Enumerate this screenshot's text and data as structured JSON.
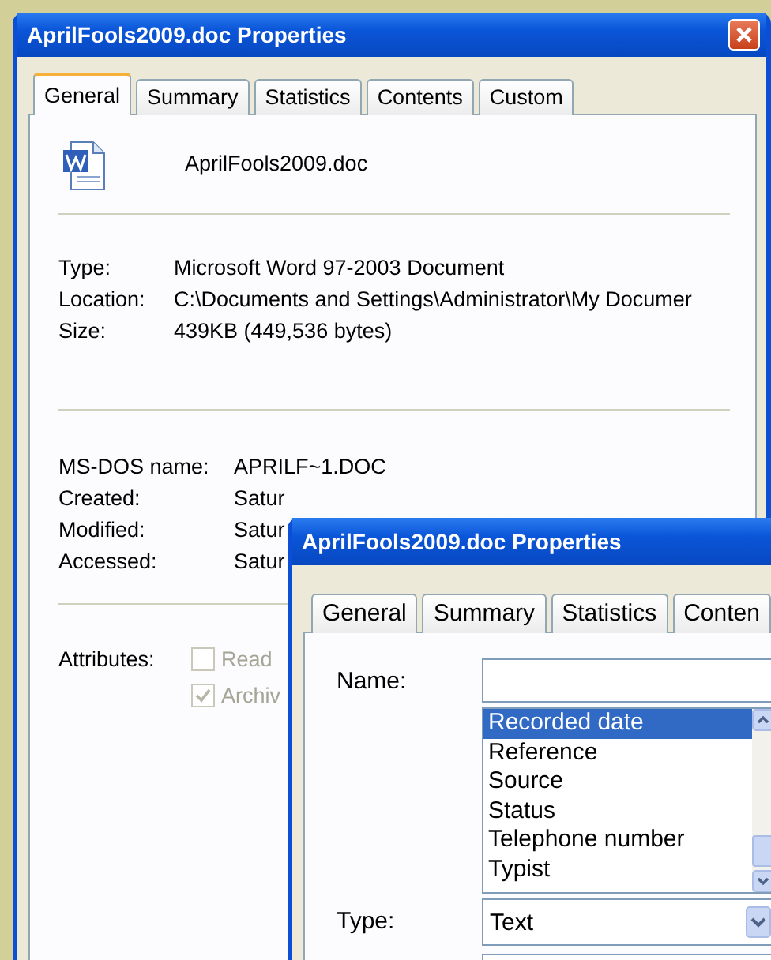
{
  "main_window": {
    "title": "AprilFools2009.doc Properties",
    "tabs": [
      {
        "label": "General",
        "selected": true
      },
      {
        "label": "Summary",
        "selected": false
      },
      {
        "label": "Statistics",
        "selected": false
      },
      {
        "label": "Contents",
        "selected": false
      },
      {
        "label": "Custom",
        "selected": false
      }
    ],
    "file_name": "AprilFools2009.doc",
    "file_info": [
      {
        "label": "Type:",
        "value": "Microsoft Word 97-2003 Document"
      },
      {
        "label": "Location:",
        "value": "C:\\Documents and Settings\\Administrator\\My Documer"
      },
      {
        "label": "Size:",
        "value": "439KB (449,536 bytes)"
      }
    ],
    "dates": [
      {
        "label": "MS-DOS name:",
        "value": "APRILF~1.DOC"
      },
      {
        "label": "Created:",
        "value": "Satur"
      },
      {
        "label": "Modified:",
        "value": "Satur"
      },
      {
        "label": "Accessed:",
        "value": "Satur"
      }
    ],
    "attributes": {
      "label": "Attributes:",
      "options": [
        {
          "label": "Read",
          "checked": false,
          "disabled": true
        },
        {
          "label": "Archiv",
          "checked": true,
          "disabled": true
        }
      ]
    }
  },
  "front_window": {
    "title": "AprilFools2009.doc Properties",
    "tabs": [
      {
        "label": "General",
        "selected": false
      },
      {
        "label": "Summary",
        "selected": false
      },
      {
        "label": "Statistics",
        "selected": false
      },
      {
        "label": "Conten",
        "selected": false
      }
    ],
    "name_label": "Name:",
    "name_list": [
      {
        "label": "Recorded date",
        "selected": true
      },
      {
        "label": "Reference",
        "selected": false
      },
      {
        "label": "Source",
        "selected": false
      },
      {
        "label": "Status",
        "selected": false
      },
      {
        "label": "Telephone number",
        "selected": false
      },
      {
        "label": "Typist",
        "selected": false
      }
    ],
    "type_label": "Type:",
    "type_value": "Text"
  }
}
